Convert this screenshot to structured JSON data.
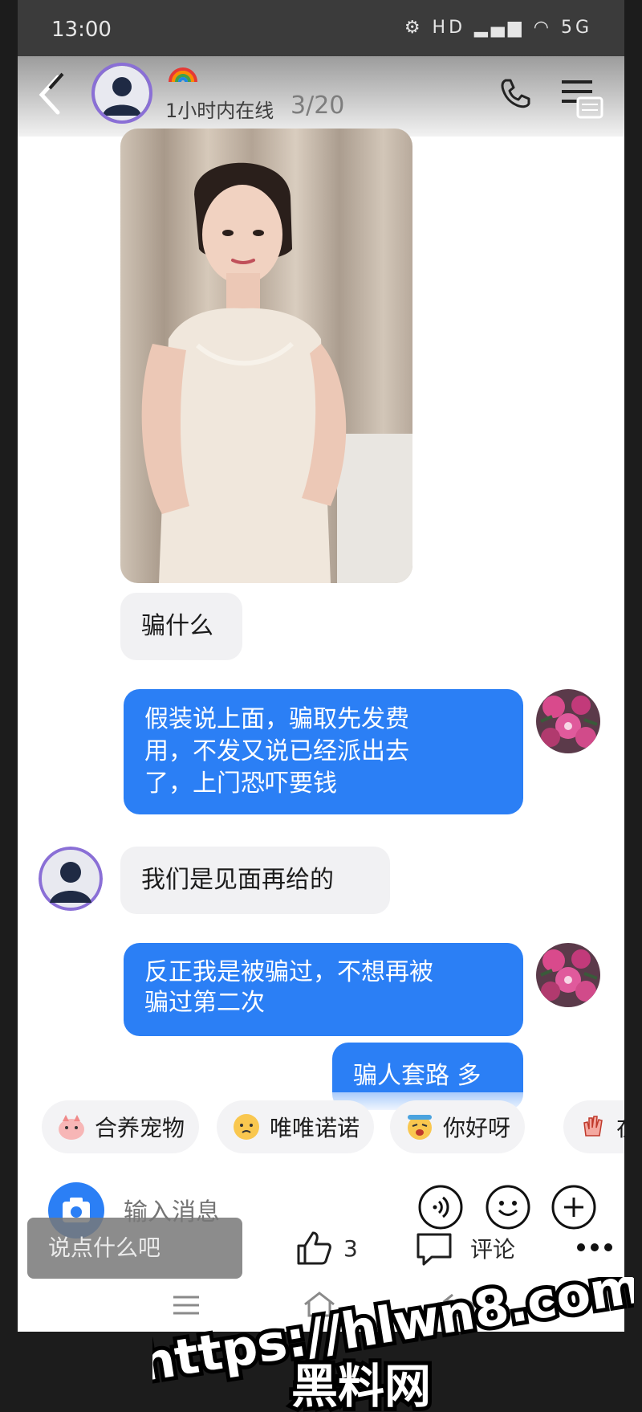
{
  "status_bar": {
    "time": "13:00",
    "indicators": "⚙ HD ▂▄▆ ◠ 5G"
  },
  "header": {
    "online_status": "1小时内在线",
    "page_counter": "3/20"
  },
  "messages": [
    {
      "side": "in",
      "text": "骗什么"
    },
    {
      "side": "out",
      "text": "假装说上面，骗取先发费\n用，不发又说已经派出去\n了，上门恐吓要钱"
    },
    {
      "side": "in",
      "text": "我们是见面再给的"
    },
    {
      "side": "out",
      "text": "反正我是被骗过，不想再被\n骗过第二次"
    },
    {
      "side": "out",
      "text": "骗人套路 多"
    }
  ],
  "quick_replies": [
    "合养宠物",
    "唯唯诺诺",
    "你好呀",
    "在一"
  ],
  "input": {
    "placeholder": "输入消息"
  },
  "comment_bar": {
    "placeholder": "说点什么吧",
    "like_count": "3",
    "comment_label": "评论"
  },
  "watermark": {
    "url": "https://hlwn8.com",
    "name": "黑料网"
  },
  "colors": {
    "accent_blue": "#2b7ff5",
    "bubble_gray": "#f1f1f3",
    "avatar_border": "#8a6fd6"
  }
}
